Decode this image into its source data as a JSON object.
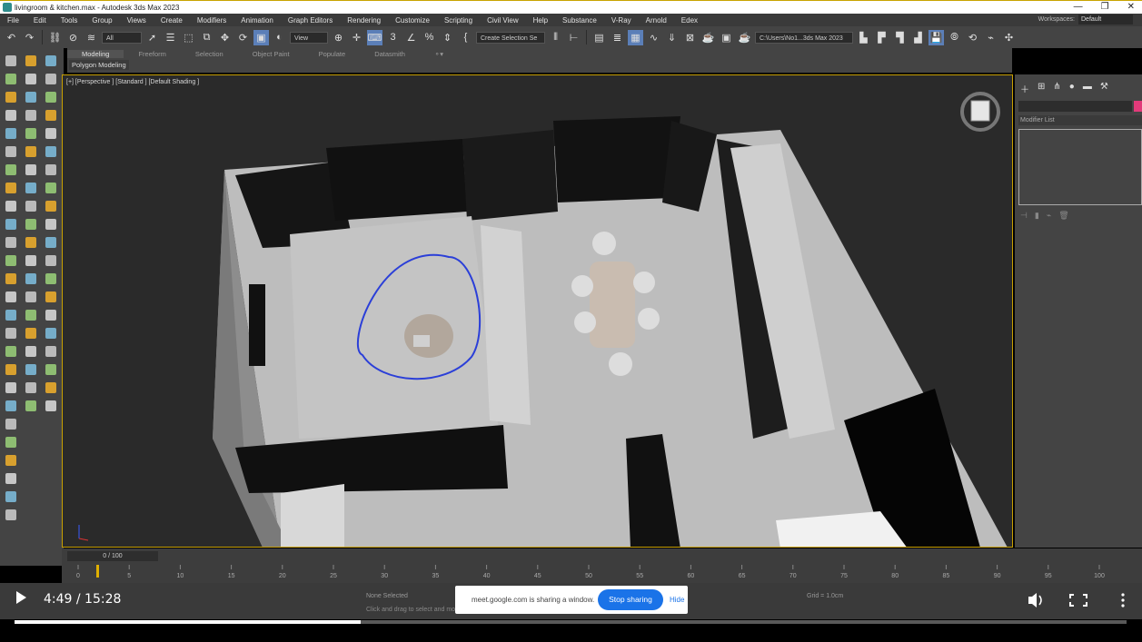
{
  "window": {
    "title": "livingroom & kitchen.max - Autodesk 3ds Max 2023",
    "minimize": "—",
    "restore": "❐",
    "close": "✕"
  },
  "menu": [
    "File",
    "Edit",
    "Tools",
    "Group",
    "Views",
    "Create",
    "Modifiers",
    "Animation",
    "Graph Editors",
    "Rendering",
    "Customize",
    "Scripting",
    "Civil View",
    "Help",
    "Substance",
    "V-Ray",
    "Arnold",
    "Edex"
  ],
  "workspaces": {
    "label": "Workspaces:",
    "value": "Default"
  },
  "toolbar": {
    "filter": "All",
    "refcoord": "View",
    "selection_set": "Create Selection Se",
    "project_path": "C:\\Users\\No1...3ds Max 2023"
  },
  "ribbon": {
    "tabs": [
      "Modeling",
      "Freeform",
      "Selection",
      "Object Paint",
      "Populate",
      "Datasmith"
    ],
    "active_tab": "Modeling",
    "subpanel": "Polygon Modeling"
  },
  "viewport": {
    "label": "[+] [Perspective ] [Standard ] [Default Shading ]"
  },
  "command_panel": {
    "modifier_list": "Modifier List",
    "accent_color": "#e23a7a"
  },
  "timeline": {
    "frame_slider": "0 / 100",
    "ticks": [
      "0",
      "5",
      "10",
      "15",
      "20",
      "25",
      "30",
      "35",
      "40",
      "45",
      "50",
      "55",
      "60",
      "65",
      "70",
      "75",
      "80",
      "85",
      "90",
      "95",
      "100"
    ]
  },
  "status": {
    "selection": "None Selected",
    "hint": "Click and drag to select and move objects",
    "grid": "Grid = 1.0cm"
  },
  "share": {
    "message": "meet.google.com is sharing a window.",
    "stop": "Stop sharing",
    "hide": "Hide"
  },
  "player": {
    "time": "4:49 / 15:28",
    "progress": 0.311
  }
}
